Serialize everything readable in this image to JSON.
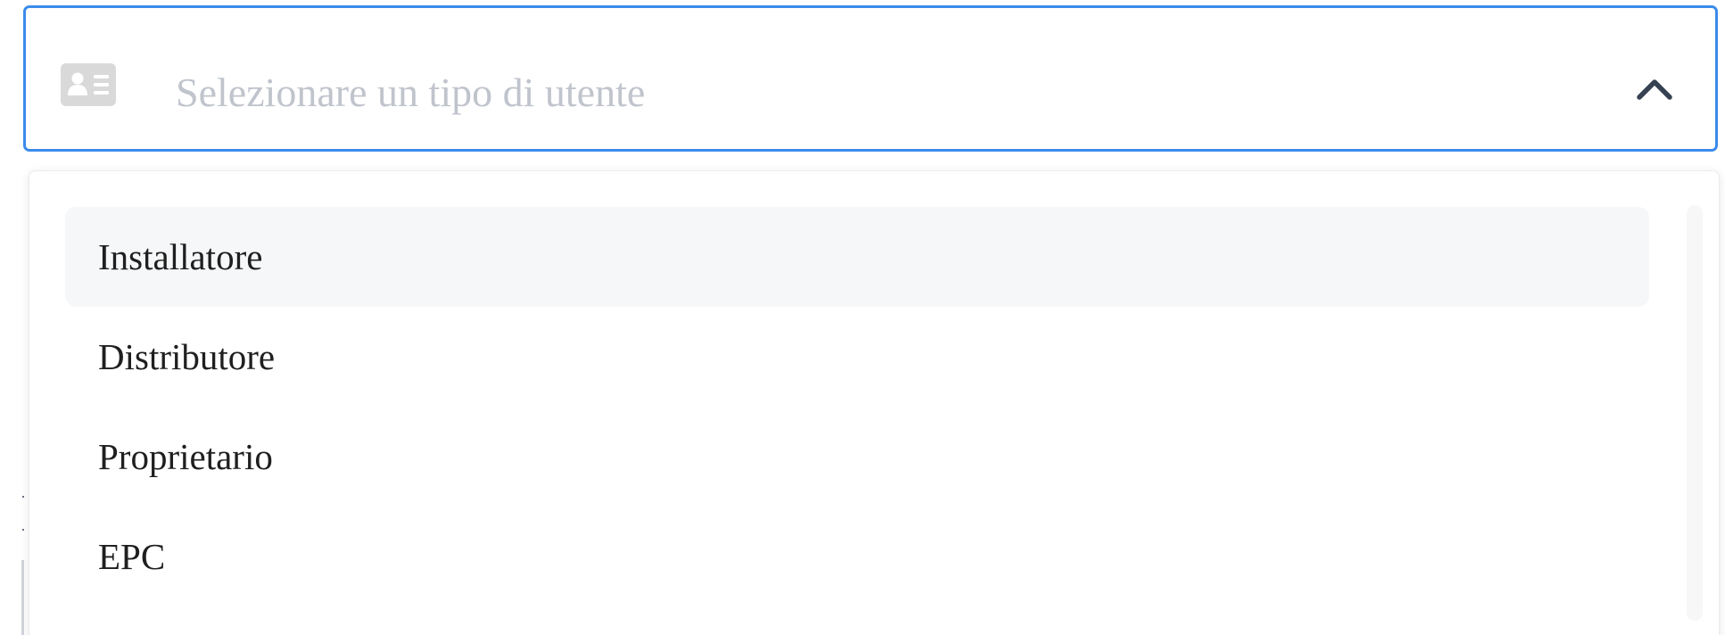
{
  "select": {
    "placeholder": "Selezionare un tipo di utente",
    "leading_icon": "id-card-icon",
    "trailing_icon": "chevron-up-icon",
    "expanded": true,
    "border_color": "#3b8beb",
    "placeholder_color": "#c0c4cc",
    "icon_color": "#d9d9d9"
  },
  "dropdown": {
    "options": [
      {
        "label": "Installatore",
        "hovered": true
      },
      {
        "label": "Distributore",
        "hovered": false
      },
      {
        "label": "Proprietario",
        "hovered": false
      },
      {
        "label": "EPC",
        "hovered": false
      }
    ],
    "hover_background": "#f6f7f9"
  }
}
